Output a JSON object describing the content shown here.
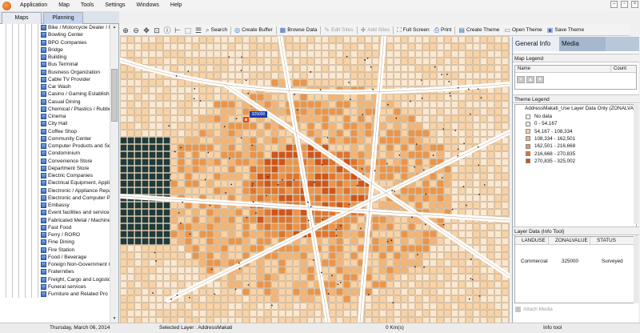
{
  "app": {
    "menu": [
      "Application",
      "Map",
      "Tools",
      "Settings",
      "Windows",
      "Help"
    ]
  },
  "left_panel": {
    "tabs": [
      "Maps",
      "Planning"
    ],
    "active_tab": "Planning",
    "items": [
      "Bike / Motorcycle Dealer / R",
      "Bowling Center",
      "BPO Companies",
      "Bridge",
      "Building",
      "Bus Terminal",
      "Business Organization",
      "Cable TV Provider",
      "Car Wash",
      "Casino / Gaming Establishm",
      "Casual Dining",
      "Chemical / Plastics / Rubbe",
      "Cinema",
      "City Hall",
      "Coffee Shop",
      "Community Center",
      "Computer Products and Se",
      "Condominium",
      "Convenience Store",
      "Department Store",
      "Electric Companies",
      "Electrical Equipment, Applia",
      "Electronic / Appliance Repa",
      "Electronic and Computer P",
      "Embassy",
      "Event facilities and service",
      "Fabricated Metal / Machine",
      "Fast Food",
      "Ferry / RORO",
      "Fine Dining",
      "Fire Station",
      "Food / Beverage",
      "Foreign Non-Government C",
      "Fraternities",
      "Freight, Cargo and Logistic",
      "Funeral services",
      "Furniture and Related Pro"
    ]
  },
  "toolbar": {
    "buttons": [
      {
        "label": "Search",
        "enabled": true
      },
      {
        "label": "Create Buffer",
        "enabled": true
      },
      {
        "label": "Browse Data",
        "enabled": true
      },
      {
        "label": "Edit Sites",
        "enabled": false
      },
      {
        "label": "Add Sites",
        "enabled": false
      },
      {
        "label": "Full Screen",
        "enabled": true
      },
      {
        "label": "Print",
        "enabled": true
      },
      {
        "label": "Create Theme",
        "enabled": true
      },
      {
        "label": "Open Theme",
        "enabled": true
      },
      {
        "label": "Save Theme",
        "enabled": true
      }
    ]
  },
  "right_panel": {
    "tabs": [
      "General Info",
      "Media"
    ],
    "map_legend": {
      "title": "Map Legend",
      "col_name": "Name",
      "col_count": "Count"
    },
    "theme_legend": {
      "title": "Theme Legend",
      "layer_title": "AddressMakati_Use Layer Data Only (ZONALVAL",
      "items": [
        {
          "label": "No data",
          "color": "#ffffff"
        },
        {
          "label": "0 - 54,167",
          "color": "#fce8cf"
        },
        {
          "label": "54,167 - 108,334",
          "color": "#f9d3a6"
        },
        {
          "label": "108,334 - 162,501",
          "color": "#f4b574"
        },
        {
          "label": "162,501 - 216,668",
          "color": "#ec9548"
        },
        {
          "label": "216,668 - 270,835",
          "color": "#e0752b"
        },
        {
          "label": "270,835 - 325,002",
          "color": "#d25419"
        }
      ]
    },
    "layer_data": {
      "title": "Layer Data (Info Tool)",
      "columns": [
        "LANDUSE",
        "ZONALVALUE",
        "STATUS"
      ],
      "row": [
        "Commercial",
        "325000",
        "Surveyed"
      ]
    },
    "attach_media": "Attach Media"
  },
  "map": {
    "selected_label": "325000"
  },
  "status": {
    "date": "Thursday, March 06, 2014",
    "selected_layer": "Selected Layer : AddressMakati",
    "distance": "0 Km(s)",
    "tool": "Info tool"
  }
}
